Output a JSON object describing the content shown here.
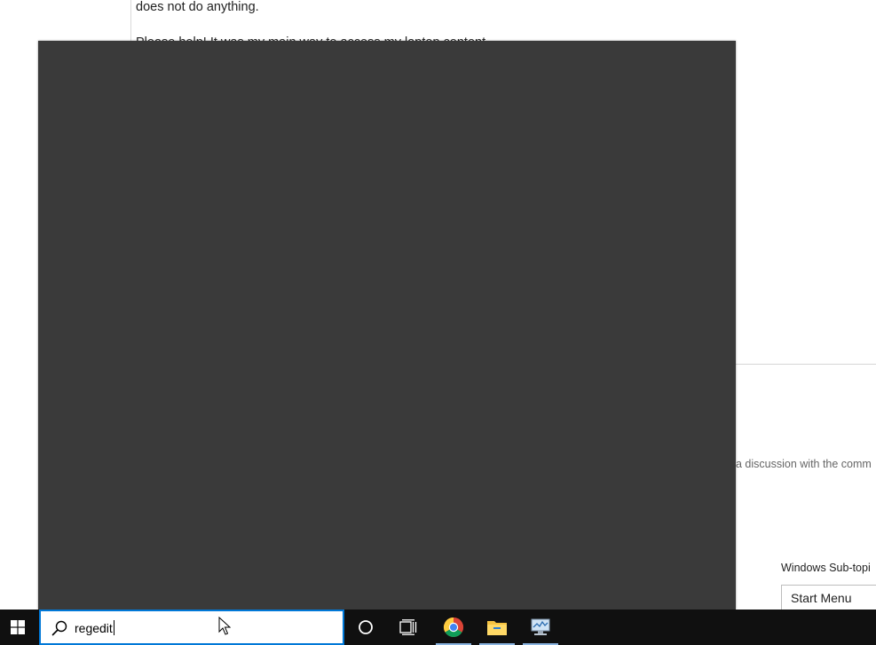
{
  "background_page": {
    "paragraph_1": "does not do anything.",
    "paragraph_2": "Please help! It was my main way to access my laptop content.",
    "discussion_text": "a discussion with the comm",
    "subtopic_label": "Windows Sub-topi",
    "subtopic_value": "Start Menu"
  },
  "taskbar": {
    "search": {
      "value": "regedit"
    },
    "icons": [
      "windows-logo-icon",
      "search-icon",
      "cortana-icon",
      "task-view-icon",
      "chrome-icon",
      "file-explorer-icon",
      "resource-monitor-icon"
    ]
  },
  "colors": {
    "taskbar_bg": "#101010",
    "flyout_bg": "#3a3a3a",
    "search_border": "#0078d7",
    "active_indicator": "#8ab4e0"
  }
}
